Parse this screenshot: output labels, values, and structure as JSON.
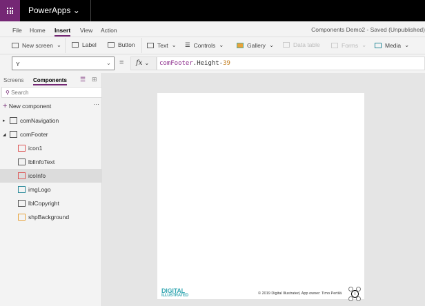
{
  "app": {
    "name": "PowerApps",
    "document_title": "Components Demo2 - Saved (Unpublished)"
  },
  "menu": [
    "File",
    "Home",
    "Insert",
    "View",
    "Action"
  ],
  "menu_active": "Insert",
  "ribbon": {
    "new_screen": "New screen",
    "label": "Label",
    "button": "Button",
    "text": "Text",
    "controls": "Controls",
    "gallery": "Gallery",
    "data_table": "Data table",
    "forms": "Forms",
    "media": "Media"
  },
  "formula_bar": {
    "property": "Y",
    "equals": "=",
    "fx": "fx",
    "formula_control": "comFooter",
    "formula_mid": ".Height-",
    "formula_num": "39"
  },
  "sidebar": {
    "tabs": [
      "Screens",
      "Components"
    ],
    "search_placeholder": "Search",
    "new_component": "New component",
    "more": "···",
    "items": [
      {
        "label": "comNavigation",
        "level": 0,
        "expander": "▸"
      },
      {
        "label": "comFooter",
        "level": 0,
        "expander": "◢"
      },
      {
        "label": "icon1",
        "level": 1
      },
      {
        "label": "lblInfoText",
        "level": 1
      },
      {
        "label": "icoInfo",
        "level": 1,
        "selected": true
      },
      {
        "label": "imgLogo",
        "level": 1
      },
      {
        "label": "lblCopyright",
        "level": 1
      },
      {
        "label": "shpBackground",
        "level": 1
      }
    ]
  },
  "canvas": {
    "logo_line1": "DIGITAL",
    "logo_line2": "ILLUSTRATED",
    "copyright": "© 2019 Digital Illustrated, App owner: Timo Pertilä",
    "info_glyph": "i"
  }
}
